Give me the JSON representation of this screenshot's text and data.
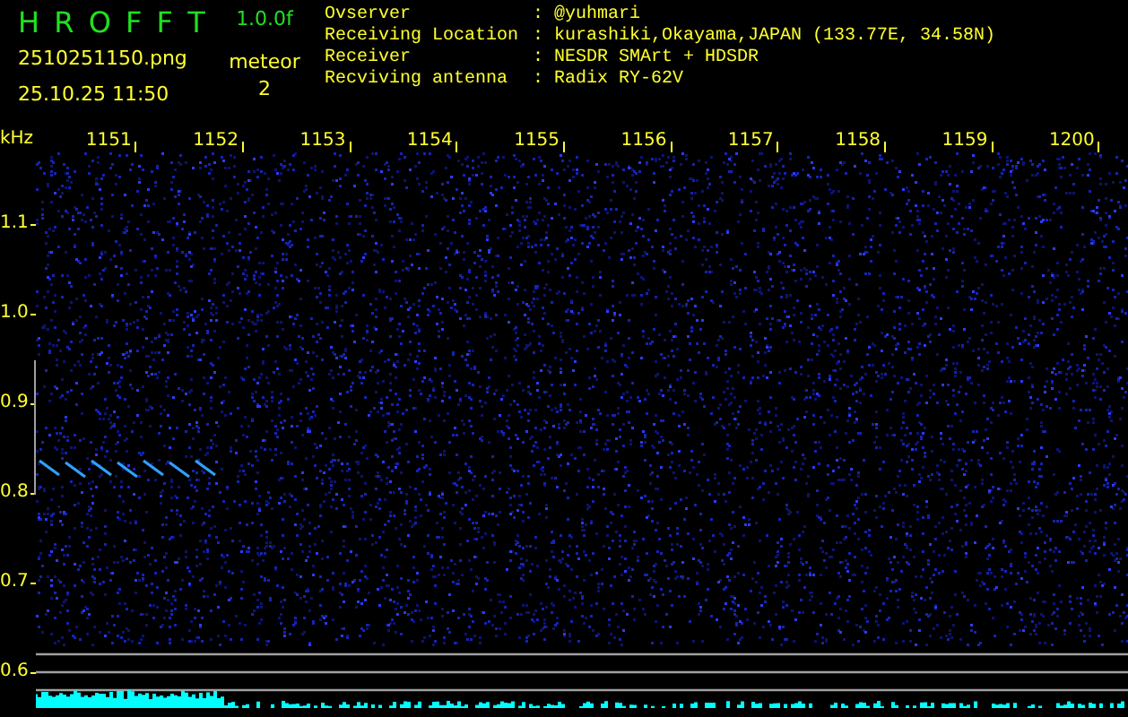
{
  "app": {
    "title": "H R O F F T",
    "version": "1.0.0f",
    "file_name": "2510251150.png",
    "timestamp": "25.10.25 11:50"
  },
  "meteor": {
    "label": "meteor",
    "count": "2"
  },
  "info": [
    {
      "label": "Ovserver",
      "separator": ":",
      "value": "@yuhmari"
    },
    {
      "label": "Receiving Location",
      "separator": ":",
      "value": "kurashiki,Okayama,JAPAN (133.77E, 34.58N)"
    },
    {
      "label": "Receiver",
      "separator": ":",
      "value": "NESDR SMArt + HDSDR"
    },
    {
      "label": "Recviving antenna",
      "separator": ":",
      "value": "Radix RY-62V"
    }
  ],
  "spectrogram": {
    "unit": "kHz",
    "time_labels": [
      "1151",
      "1152",
      "1153",
      "1154",
      "1155",
      "1156",
      "1157",
      "1158",
      "1159",
      "1200"
    ],
    "frequency_labels": [
      "1.1",
      "1.0",
      "0.9",
      "0.8",
      "0.7",
      "0.6"
    ]
  }
}
